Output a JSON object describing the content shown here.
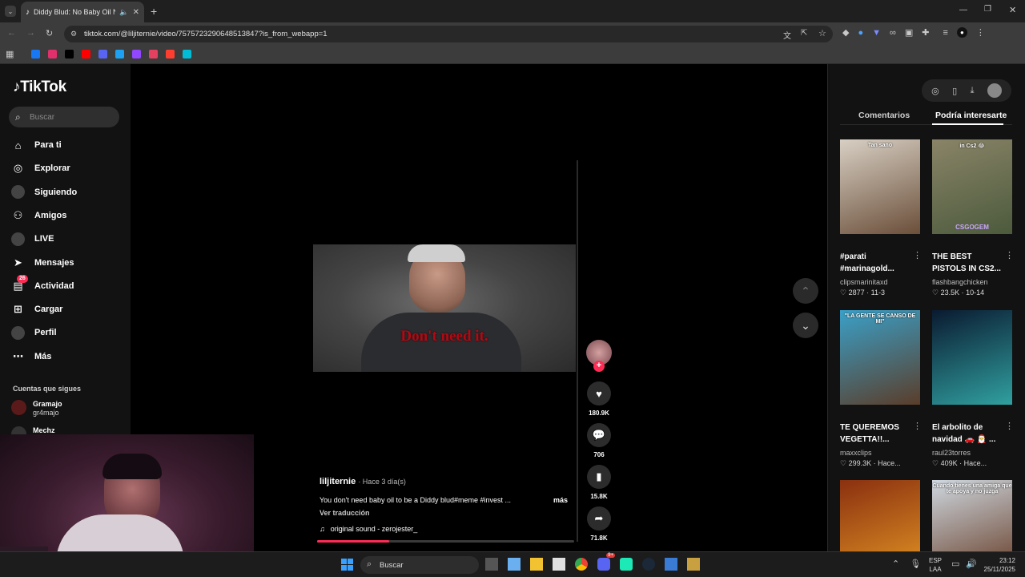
{
  "browser": {
    "tab_title": "Diddy Blud: No Baby Oil Ne",
    "url": "tiktok.com/@liljiternie/video/7575723290648513847?is_from_webapp=1",
    "new_tab": "+",
    "window_controls": [
      "minimize-icon",
      "restore-icon",
      "close-icon"
    ],
    "bookmark_colors": [
      "#1877f2",
      "#e1306c",
      "#000000",
      "#ff0000",
      "#5865f2",
      "#1da1f2",
      "#9146ff",
      "#e4405f",
      "#ff3e30",
      "#00bcd4"
    ]
  },
  "nav": {
    "logo": "TikTok",
    "search_placeholder": "Buscar",
    "items": [
      {
        "label": "Para ti",
        "icon": "home-icon"
      },
      {
        "label": "Explorar",
        "icon": "compass-icon"
      },
      {
        "label": "Siguiendo",
        "icon": "following-icon"
      },
      {
        "label": "Amigos",
        "icon": "friends-icon"
      },
      {
        "label": "LIVE",
        "icon": "live-icon"
      },
      {
        "label": "Mensajes",
        "icon": "send-icon"
      },
      {
        "label": "Actividad",
        "icon": "inbox-icon",
        "badge": "26"
      },
      {
        "label": "Cargar",
        "icon": "upload-icon"
      },
      {
        "label": "Perfil",
        "icon": "profile-icon"
      },
      {
        "label": "Más",
        "icon": "more-icon"
      }
    ],
    "following_header": "Cuentas que sigues",
    "accounts": [
      {
        "name": "Gramajo",
        "handle": "gr4majo"
      },
      {
        "name": "Mechz",
        "handle": ""
      }
    ]
  },
  "video": {
    "overlay_text": "Don't need it.",
    "author": "liljiternie",
    "time_ago": "· Hace 3 día(s)",
    "description": "You don't need baby oil to be a Diddy blud#meme #invest ...",
    "more": "más",
    "translate": "Ver traducción",
    "sound": "original sound - zerojester_",
    "progress_pct": 28
  },
  "actions": {
    "likes": "180.9K",
    "comments": "706",
    "saves": "15.8K",
    "shares": "71.8K"
  },
  "sidebar": {
    "tabs": [
      "Comentarios",
      "Podría interesarte"
    ],
    "active_tab": 1,
    "cards": [
      {
        "title": "#parati #marinagold...",
        "user": "clipsmarinitaxd",
        "likes": "2877",
        "date": "11-3",
        "thumb_text": "Tan sano",
        "colors": [
          "#d8d0c4",
          "#6b4f3a"
        ]
      },
      {
        "title": "THE BEST PISTOLS IN CS2...",
        "user": "flashbangchicken",
        "likes": "23.5K",
        "date": "10-14",
        "thumb_text": "in Cs2 😂",
        "badge": "CSGOGEM",
        "colors": [
          "#8a8468",
          "#4c5a3c"
        ]
      },
      {
        "title": "TE QUEREMOS VEGETTA!!...",
        "user": "maxxclips",
        "likes": "299.3K",
        "date": "Hace...",
        "thumb_text": "\"LA GENTE SE CANSO DE MI\"",
        "colors": [
          "#3aa0c8",
          "#5a3d2a"
        ]
      },
      {
        "title": "El arbolito de navidad 🚗 🎅 ...",
        "user": "raul23torres",
        "likes": "409K",
        "date": "Hace...",
        "thumb_text": "",
        "colors": [
          "#0a1a30",
          "#30a0a0"
        ]
      },
      {
        "title": "",
        "user": "",
        "likes": "",
        "date": "",
        "thumb_text": "",
        "colors": [
          "#8a3010",
          "#d08020"
        ]
      },
      {
        "title": "",
        "user": "",
        "likes": "",
        "date": "",
        "thumb_text": "Cuando tienes una amiga que te apoya y no juzga",
        "colors": [
          "#cfd8e0",
          "#7a5a4a"
        ]
      }
    ]
  },
  "taskbar": {
    "search": "Buscar",
    "lang": "ESP",
    "region": "LAA",
    "time": "23:12",
    "date": "25/11/2025",
    "discord_badge": "9+"
  }
}
